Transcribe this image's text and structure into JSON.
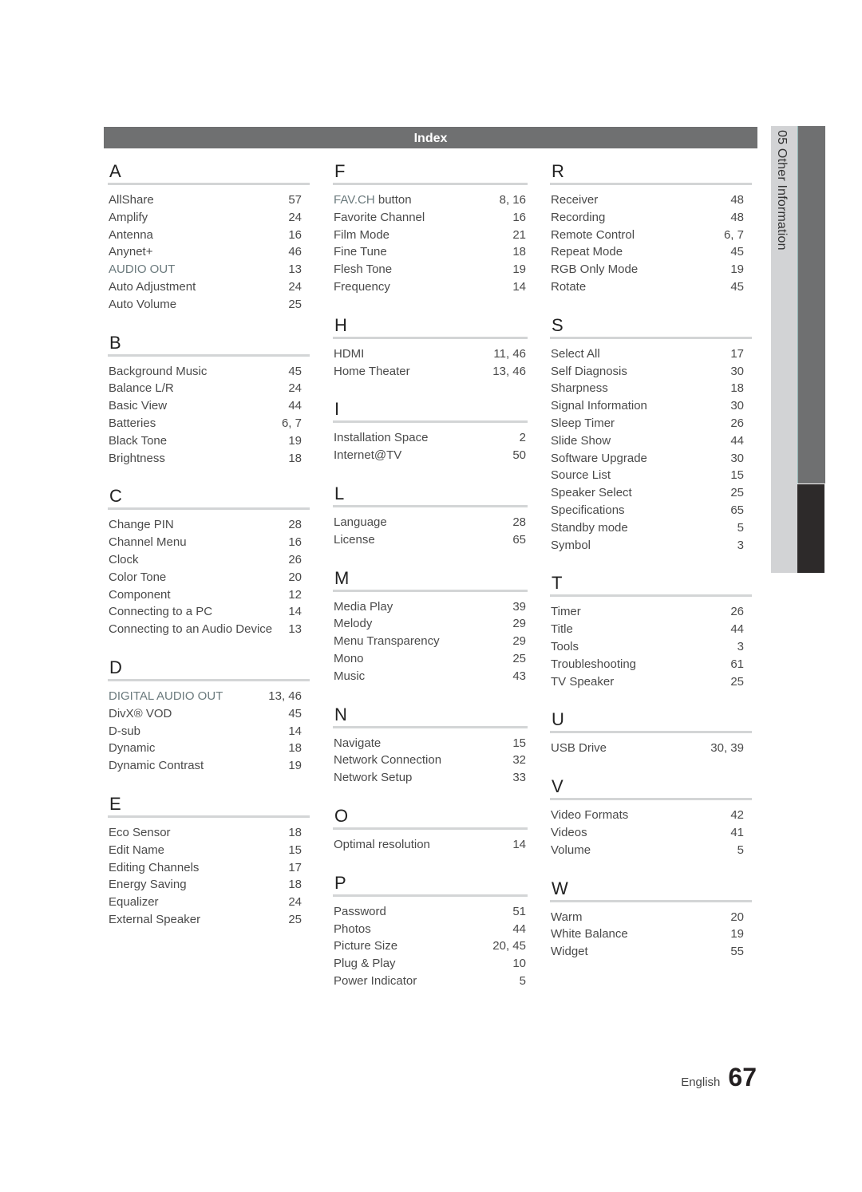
{
  "header": {
    "title": "Index"
  },
  "side_tab": {
    "label": "05  Other Information"
  },
  "footer": {
    "language": "English",
    "page_number": "67"
  },
  "columns": [
    [
      {
        "letter": "A",
        "entries": [
          {
            "term": "AllShare",
            "pages": "57"
          },
          {
            "term": "Amplify",
            "pages": "24"
          },
          {
            "term": "Antenna",
            "pages": "16"
          },
          {
            "term": "Anynet+",
            "pages": "46"
          },
          {
            "term": "AUDIO OUT",
            "pages": "13",
            "emph": true
          },
          {
            "term": "Auto Adjustment",
            "pages": "24"
          },
          {
            "term": "Auto Volume",
            "pages": "25"
          }
        ]
      },
      {
        "letter": "B",
        "entries": [
          {
            "term": "Background Music",
            "pages": "45"
          },
          {
            "term": "Balance L/R",
            "pages": "24"
          },
          {
            "term": "Basic View",
            "pages": "44"
          },
          {
            "term": "Batteries",
            "pages": "6, 7"
          },
          {
            "term": "Black Tone",
            "pages": "19"
          },
          {
            "term": "Brightness",
            "pages": "18"
          }
        ]
      },
      {
        "letter": "C",
        "entries": [
          {
            "term": "Change PIN",
            "pages": "28"
          },
          {
            "term": "Channel Menu",
            "pages": "16"
          },
          {
            "term": "Clock",
            "pages": "26"
          },
          {
            "term": "Color Tone",
            "pages": "20"
          },
          {
            "term": "Component",
            "pages": "12"
          },
          {
            "term": "Connecting to a PC",
            "pages": "14"
          },
          {
            "term": "Connecting to an Audio Device",
            "pages": "13"
          }
        ]
      },
      {
        "letter": "D",
        "entries": [
          {
            "term": "DIGITAL AUDIO OUT",
            "pages": "13, 46",
            "emph": true
          },
          {
            "term": "DivX® VOD",
            "pages": "45"
          },
          {
            "term": "D-sub",
            "pages": "14"
          },
          {
            "term": "Dynamic",
            "pages": "18"
          },
          {
            "term": "Dynamic Contrast",
            "pages": "19"
          }
        ]
      },
      {
        "letter": "E",
        "entries": [
          {
            "term": "Eco Sensor",
            "pages": "18"
          },
          {
            "term": "Edit Name",
            "pages": "15"
          },
          {
            "term": "Editing Channels",
            "pages": "17"
          },
          {
            "term": "Energy Saving",
            "pages": "18"
          },
          {
            "term": "Equalizer",
            "pages": "24"
          },
          {
            "term": "External Speaker",
            "pages": "25"
          }
        ]
      }
    ],
    [
      {
        "letter": "F",
        "entries": [
          {
            "term": "FAV.CH",
            "term_suffix": " button",
            "pages": "8, 16",
            "emph": true
          },
          {
            "term": "Favorite Channel",
            "pages": "16"
          },
          {
            "term": "Film Mode",
            "pages": "21"
          },
          {
            "term": "Fine Tune",
            "pages": "18"
          },
          {
            "term": "Flesh Tone",
            "pages": "19"
          },
          {
            "term": "Frequency",
            "pages": "14"
          }
        ]
      },
      {
        "letter": "H",
        "entries": [
          {
            "term": "HDMI",
            "pages": "11, 46"
          },
          {
            "term": "Home Theater",
            "pages": "13, 46"
          }
        ]
      },
      {
        "letter": "I",
        "entries": [
          {
            "term": "Installation Space",
            "pages": "2"
          },
          {
            "term": "Internet@TV",
            "pages": "50"
          }
        ]
      },
      {
        "letter": "L",
        "entries": [
          {
            "term": "Language",
            "pages": "28"
          },
          {
            "term": "License",
            "pages": "65"
          }
        ]
      },
      {
        "letter": "M",
        "entries": [
          {
            "term": "Media Play",
            "pages": "39"
          },
          {
            "term": "Melody",
            "pages": "29"
          },
          {
            "term": "Menu Transparency",
            "pages": "29"
          },
          {
            "term": "Mono",
            "pages": "25"
          },
          {
            "term": "Music",
            "pages": "43"
          }
        ]
      },
      {
        "letter": "N",
        "entries": [
          {
            "term": "Navigate",
            "pages": "15"
          },
          {
            "term": "Network Connection",
            "pages": "32"
          },
          {
            "term": "Network Setup",
            "pages": "33"
          }
        ]
      },
      {
        "letter": "O",
        "entries": [
          {
            "term": "Optimal resolution",
            "pages": "14"
          }
        ]
      },
      {
        "letter": "P",
        "entries": [
          {
            "term": "Password",
            "pages": "51"
          },
          {
            "term": "Photos",
            "pages": "44"
          },
          {
            "term": "Picture Size",
            "pages": "20, 45"
          },
          {
            "term": "Plug & Play",
            "pages": "10"
          },
          {
            "term": "Power Indicator",
            "pages": "5"
          }
        ]
      }
    ],
    [
      {
        "letter": "R",
        "entries": [
          {
            "term": "Receiver",
            "pages": "48"
          },
          {
            "term": "Recording",
            "pages": "48"
          },
          {
            "term": "Remote Control",
            "pages": "6, 7"
          },
          {
            "term": "Repeat Mode",
            "pages": "45"
          },
          {
            "term": "RGB Only Mode",
            "pages": "19"
          },
          {
            "term": "Rotate",
            "pages": "45"
          }
        ]
      },
      {
        "letter": "S",
        "entries": [
          {
            "term": "Select All",
            "pages": "17"
          },
          {
            "term": "Self Diagnosis",
            "pages": "30"
          },
          {
            "term": "Sharpness",
            "pages": "18"
          },
          {
            "term": "Signal Information",
            "pages": "30"
          },
          {
            "term": "Sleep Timer",
            "pages": "26"
          },
          {
            "term": "Slide Show",
            "pages": "44"
          },
          {
            "term": "Software Upgrade",
            "pages": "30"
          },
          {
            "term": "Source List",
            "pages": "15"
          },
          {
            "term": "Speaker Select",
            "pages": "25"
          },
          {
            "term": "Specifications",
            "pages": "65"
          },
          {
            "term": "Standby mode",
            "pages": "5"
          },
          {
            "term": "Symbol",
            "pages": "3"
          }
        ]
      },
      {
        "letter": "T",
        "entries": [
          {
            "term": "Timer",
            "pages": "26"
          },
          {
            "term": "Title",
            "pages": "44"
          },
          {
            "term": "Tools",
            "pages": "3"
          },
          {
            "term": "Troubleshooting",
            "pages": "61"
          },
          {
            "term": "TV Speaker",
            "pages": "25"
          }
        ]
      },
      {
        "letter": "U",
        "entries": [
          {
            "term": "USB Drive",
            "pages": "30, 39"
          }
        ]
      },
      {
        "letter": "V",
        "entries": [
          {
            "term": "Video Formats",
            "pages": "42"
          },
          {
            "term": "Videos",
            "pages": "41"
          },
          {
            "term": "Volume",
            "pages": "5"
          }
        ]
      },
      {
        "letter": "W",
        "entries": [
          {
            "term": "Warm",
            "pages": "20"
          },
          {
            "term": "White Balance",
            "pages": "19"
          },
          {
            "term": "Widget",
            "pages": "55"
          }
        ]
      }
    ]
  ]
}
